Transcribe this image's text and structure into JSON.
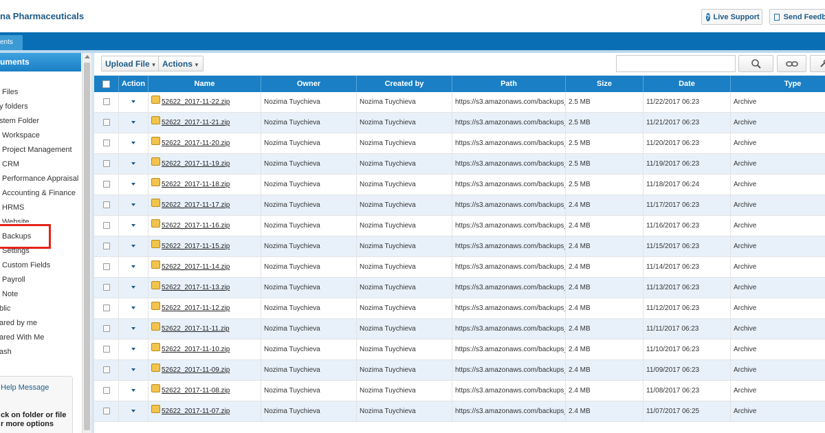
{
  "header": {
    "company": "na Pharmaceuticals",
    "live_support": "Live Support",
    "send_feedback": "Send Feedb"
  },
  "tab": {
    "label": "ents"
  },
  "sidebar": {
    "title": "uments",
    "items": [
      {
        "label": "Files"
      },
      {
        "label": "y folders"
      },
      {
        "label": "stem Folder"
      },
      {
        "label": "Workspace"
      },
      {
        "label": "Project Management"
      },
      {
        "label": "CRM"
      },
      {
        "label": "Performance Appraisal"
      },
      {
        "label": "Accounting & Finance"
      },
      {
        "label": "HRMS"
      },
      {
        "label": "Website"
      },
      {
        "label": "Backups"
      },
      {
        "label": "Settings"
      },
      {
        "label": "Custom Fields"
      },
      {
        "label": "Payroll"
      },
      {
        "label": "Note"
      },
      {
        "label": "blic"
      },
      {
        "label": "ared by me"
      },
      {
        "label": "ared With Me"
      },
      {
        "label": "ash"
      }
    ],
    "help_title": "Help Message",
    "help_line1": "ck on folder or file",
    "help_line2": "r more options"
  },
  "toolbar": {
    "upload_label": "Upload File",
    "actions_label": "Actions",
    "search_value": ""
  },
  "table": {
    "columns": [
      "",
      "Action",
      "Name",
      "Owner",
      "Created by",
      "Path",
      "Size",
      "Date",
      "Type"
    ],
    "rows": [
      {
        "name": "52622_2017-11-22.zip",
        "owner": "Nozima Tuychieva",
        "created_by": "Nozima Tuychieva",
        "path": "https://s3.amazonaws.com/backups_",
        "size": "2.5 MB",
        "date": "11/22/2017 06:23",
        "type": "Archive"
      },
      {
        "name": "52622_2017-11-21.zip",
        "owner": "Nozima Tuychieva",
        "created_by": "Nozima Tuychieva",
        "path": "https://s3.amazonaws.com/backups_",
        "size": "2.5 MB",
        "date": "11/21/2017 06:23",
        "type": "Archive"
      },
      {
        "name": "52622_2017-11-20.zip",
        "owner": "Nozima Tuychieva",
        "created_by": "Nozima Tuychieva",
        "path": "https://s3.amazonaws.com/backups_",
        "size": "2.5 MB",
        "date": "11/20/2017 06:23",
        "type": "Archive"
      },
      {
        "name": "52622_2017-11-19.zip",
        "owner": "Nozima Tuychieva",
        "created_by": "Nozima Tuychieva",
        "path": "https://s3.amazonaws.com/backups_",
        "size": "2.5 MB",
        "date": "11/19/2017 06:23",
        "type": "Archive"
      },
      {
        "name": "52622_2017-11-18.zip",
        "owner": "Nozima Tuychieva",
        "created_by": "Nozima Tuychieva",
        "path": "https://s3.amazonaws.com/backups_",
        "size": "2.5 MB",
        "date": "11/18/2017 06:24",
        "type": "Archive"
      },
      {
        "name": "52622_2017-11-17.zip",
        "owner": "Nozima Tuychieva",
        "created_by": "Nozima Tuychieva",
        "path": "https://s3.amazonaws.com/backups_",
        "size": "2.4 MB",
        "date": "11/17/2017 06:23",
        "type": "Archive"
      },
      {
        "name": "52622_2017-11-16.zip",
        "owner": "Nozima Tuychieva",
        "created_by": "Nozima Tuychieva",
        "path": "https://s3.amazonaws.com/backups_",
        "size": "2.4 MB",
        "date": "11/16/2017 06:23",
        "type": "Archive"
      },
      {
        "name": "52622_2017-11-15.zip",
        "owner": "Nozima Tuychieva",
        "created_by": "Nozima Tuychieva",
        "path": "https://s3.amazonaws.com/backups_",
        "size": "2.4 MB",
        "date": "11/15/2017 06:23",
        "type": "Archive"
      },
      {
        "name": "52622_2017-11-14.zip",
        "owner": "Nozima Tuychieva",
        "created_by": "Nozima Tuychieva",
        "path": "https://s3.amazonaws.com/backups_",
        "size": "2.4 MB",
        "date": "11/14/2017 06:23",
        "type": "Archive"
      },
      {
        "name": "52622_2017-11-13.zip",
        "owner": "Nozima Tuychieva",
        "created_by": "Nozima Tuychieva",
        "path": "https://s3.amazonaws.com/backups_",
        "size": "2.4 MB",
        "date": "11/13/2017 06:23",
        "type": "Archive"
      },
      {
        "name": "52622_2017-11-12.zip",
        "owner": "Nozima Tuychieva",
        "created_by": "Nozima Tuychieva",
        "path": "https://s3.amazonaws.com/backups_",
        "size": "2.4 MB",
        "date": "11/12/2017 06:23",
        "type": "Archive"
      },
      {
        "name": "52622_2017-11-11.zip",
        "owner": "Nozima Tuychieva",
        "created_by": "Nozima Tuychieva",
        "path": "https://s3.amazonaws.com/backups_",
        "size": "2.4 MB",
        "date": "11/11/2017 06:23",
        "type": "Archive"
      },
      {
        "name": "52622_2017-11-10.zip",
        "owner": "Nozima Tuychieva",
        "created_by": "Nozima Tuychieva",
        "path": "https://s3.amazonaws.com/backups_",
        "size": "2.4 MB",
        "date": "11/10/2017 06:23",
        "type": "Archive"
      },
      {
        "name": "52622_2017-11-09.zip",
        "owner": "Nozima Tuychieva",
        "created_by": "Nozima Tuychieva",
        "path": "https://s3.amazonaws.com/backups_",
        "size": "2.4 MB",
        "date": "11/09/2017 06:23",
        "type": "Archive"
      },
      {
        "name": "52622_2017-11-08.zip",
        "owner": "Nozima Tuychieva",
        "created_by": "Nozima Tuychieva",
        "path": "https://s3.amazonaws.com/backups_",
        "size": "2.4 MB",
        "date": "11/08/2017 06:23",
        "type": "Archive"
      },
      {
        "name": "52622_2017-11-07.zip",
        "owner": "Nozima Tuychieva",
        "created_by": "Nozima Tuychieva",
        "path": "https://s3.amazonaws.com/backups_",
        "size": "2.4 MB",
        "date": "11/07/2017 06:25",
        "type": "Archive"
      }
    ]
  }
}
